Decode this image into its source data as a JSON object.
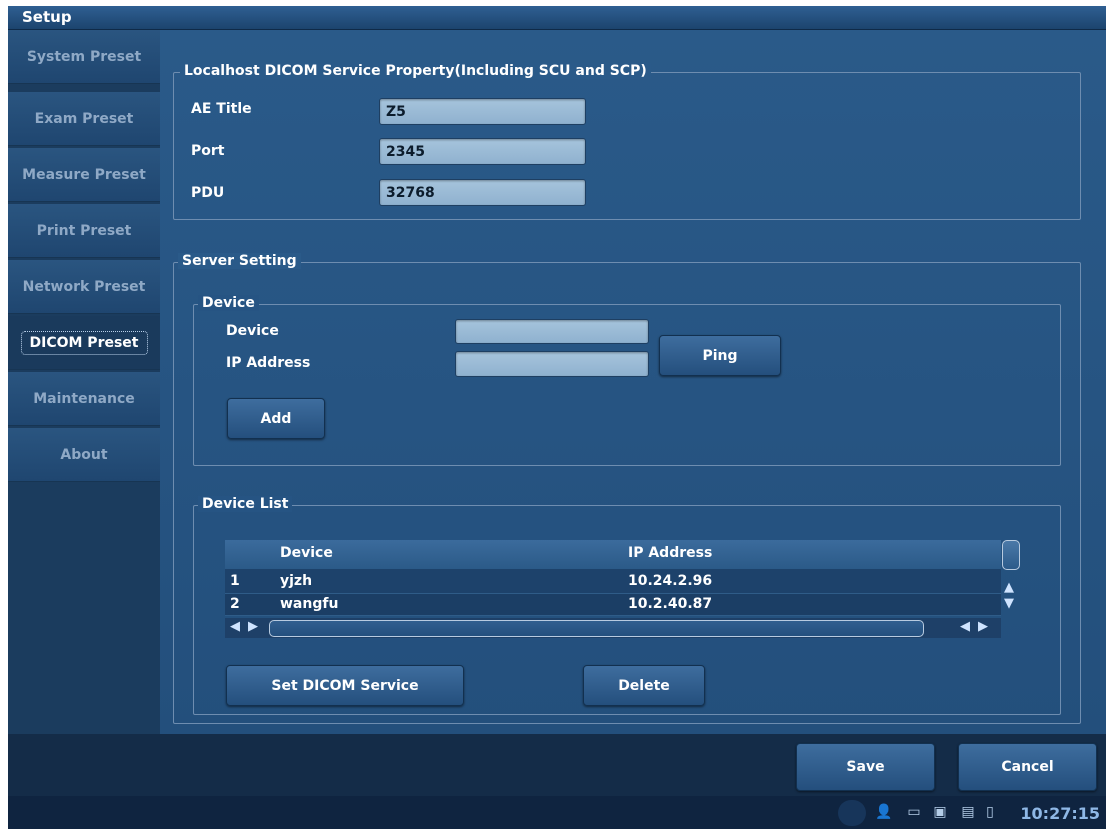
{
  "window": {
    "title": "Setup"
  },
  "sidebar": {
    "items": [
      {
        "label": "System Preset",
        "active": false
      },
      {
        "label": "Exam Preset",
        "active": false
      },
      {
        "label": "Measure Preset",
        "active": false
      },
      {
        "label": "Print Preset",
        "active": false
      },
      {
        "label": "Network Preset",
        "active": false
      },
      {
        "label": "DICOM Preset",
        "active": true
      },
      {
        "label": "Maintenance",
        "active": false
      },
      {
        "label": "About",
        "active": false
      }
    ]
  },
  "localhost": {
    "legend": "Localhost DICOM Service Property(Including SCU and SCP)",
    "ae_title_label": "AE Title",
    "ae_title_value": "Z5",
    "port_label": "Port",
    "port_value": "2345",
    "pdu_label": "PDU",
    "pdu_value": "32768"
  },
  "server": {
    "legend": "Server Setting",
    "device_group": {
      "legend": "Device",
      "device_label": "Device",
      "device_value": "",
      "ip_label": "IP Address",
      "ip_value": "",
      "ping_label": "Ping",
      "add_label": "Add"
    },
    "device_list": {
      "legend": "Device List",
      "columns": [
        "Device",
        "IP Address"
      ],
      "rows": [
        {
          "index": "1",
          "device": "yjzh",
          "ip": "10.24.2.96"
        },
        {
          "index": "2",
          "device": "wangfu",
          "ip": "10.2.40.87"
        }
      ],
      "set_service_label": "Set DICOM Service",
      "delete_label": "Delete"
    }
  },
  "footer": {
    "save_label": "Save",
    "cancel_label": "Cancel"
  },
  "status": {
    "clock": "10:27:15"
  },
  "colors": {
    "background": "#234668",
    "accent": "#2a5a89",
    "clock": "#8fb8e6"
  }
}
